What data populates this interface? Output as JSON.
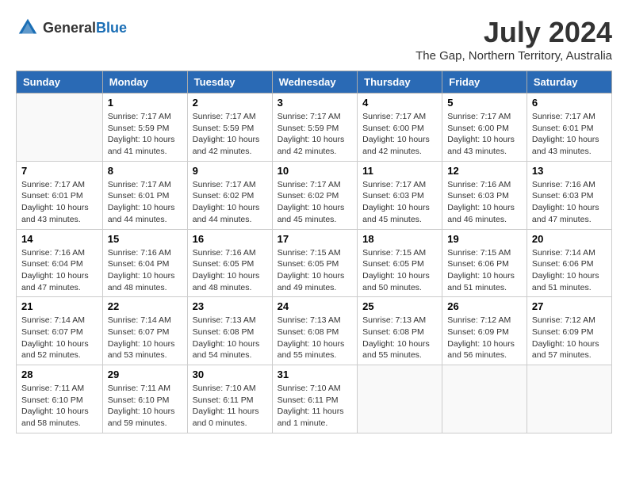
{
  "logo": {
    "general": "General",
    "blue": "Blue"
  },
  "title": {
    "month_year": "July 2024",
    "location": "The Gap, Northern Territory, Australia"
  },
  "headers": [
    "Sunday",
    "Monday",
    "Tuesday",
    "Wednesday",
    "Thursday",
    "Friday",
    "Saturday"
  ],
  "weeks": [
    [
      {
        "day": "",
        "info": ""
      },
      {
        "day": "1",
        "info": "Sunrise: 7:17 AM\nSunset: 5:59 PM\nDaylight: 10 hours\nand 41 minutes."
      },
      {
        "day": "2",
        "info": "Sunrise: 7:17 AM\nSunset: 5:59 PM\nDaylight: 10 hours\nand 42 minutes."
      },
      {
        "day": "3",
        "info": "Sunrise: 7:17 AM\nSunset: 5:59 PM\nDaylight: 10 hours\nand 42 minutes."
      },
      {
        "day": "4",
        "info": "Sunrise: 7:17 AM\nSunset: 6:00 PM\nDaylight: 10 hours\nand 42 minutes."
      },
      {
        "day": "5",
        "info": "Sunrise: 7:17 AM\nSunset: 6:00 PM\nDaylight: 10 hours\nand 43 minutes."
      },
      {
        "day": "6",
        "info": "Sunrise: 7:17 AM\nSunset: 6:01 PM\nDaylight: 10 hours\nand 43 minutes."
      }
    ],
    [
      {
        "day": "7",
        "info": "Sunrise: 7:17 AM\nSunset: 6:01 PM\nDaylight: 10 hours\nand 43 minutes."
      },
      {
        "day": "8",
        "info": "Sunrise: 7:17 AM\nSunset: 6:01 PM\nDaylight: 10 hours\nand 44 minutes."
      },
      {
        "day": "9",
        "info": "Sunrise: 7:17 AM\nSunset: 6:02 PM\nDaylight: 10 hours\nand 44 minutes."
      },
      {
        "day": "10",
        "info": "Sunrise: 7:17 AM\nSunset: 6:02 PM\nDaylight: 10 hours\nand 45 minutes."
      },
      {
        "day": "11",
        "info": "Sunrise: 7:17 AM\nSunset: 6:03 PM\nDaylight: 10 hours\nand 45 minutes."
      },
      {
        "day": "12",
        "info": "Sunrise: 7:16 AM\nSunset: 6:03 PM\nDaylight: 10 hours\nand 46 minutes."
      },
      {
        "day": "13",
        "info": "Sunrise: 7:16 AM\nSunset: 6:03 PM\nDaylight: 10 hours\nand 47 minutes."
      }
    ],
    [
      {
        "day": "14",
        "info": "Sunrise: 7:16 AM\nSunset: 6:04 PM\nDaylight: 10 hours\nand 47 minutes."
      },
      {
        "day": "15",
        "info": "Sunrise: 7:16 AM\nSunset: 6:04 PM\nDaylight: 10 hours\nand 48 minutes."
      },
      {
        "day": "16",
        "info": "Sunrise: 7:16 AM\nSunset: 6:05 PM\nDaylight: 10 hours\nand 48 minutes."
      },
      {
        "day": "17",
        "info": "Sunrise: 7:15 AM\nSunset: 6:05 PM\nDaylight: 10 hours\nand 49 minutes."
      },
      {
        "day": "18",
        "info": "Sunrise: 7:15 AM\nSunset: 6:05 PM\nDaylight: 10 hours\nand 50 minutes."
      },
      {
        "day": "19",
        "info": "Sunrise: 7:15 AM\nSunset: 6:06 PM\nDaylight: 10 hours\nand 51 minutes."
      },
      {
        "day": "20",
        "info": "Sunrise: 7:14 AM\nSunset: 6:06 PM\nDaylight: 10 hours\nand 51 minutes."
      }
    ],
    [
      {
        "day": "21",
        "info": "Sunrise: 7:14 AM\nSunset: 6:07 PM\nDaylight: 10 hours\nand 52 minutes."
      },
      {
        "day": "22",
        "info": "Sunrise: 7:14 AM\nSunset: 6:07 PM\nDaylight: 10 hours\nand 53 minutes."
      },
      {
        "day": "23",
        "info": "Sunrise: 7:13 AM\nSunset: 6:08 PM\nDaylight: 10 hours\nand 54 minutes."
      },
      {
        "day": "24",
        "info": "Sunrise: 7:13 AM\nSunset: 6:08 PM\nDaylight: 10 hours\nand 55 minutes."
      },
      {
        "day": "25",
        "info": "Sunrise: 7:13 AM\nSunset: 6:08 PM\nDaylight: 10 hours\nand 55 minutes."
      },
      {
        "day": "26",
        "info": "Sunrise: 7:12 AM\nSunset: 6:09 PM\nDaylight: 10 hours\nand 56 minutes."
      },
      {
        "day": "27",
        "info": "Sunrise: 7:12 AM\nSunset: 6:09 PM\nDaylight: 10 hours\nand 57 minutes."
      }
    ],
    [
      {
        "day": "28",
        "info": "Sunrise: 7:11 AM\nSunset: 6:10 PM\nDaylight: 10 hours\nand 58 minutes."
      },
      {
        "day": "29",
        "info": "Sunrise: 7:11 AM\nSunset: 6:10 PM\nDaylight: 10 hours\nand 59 minutes."
      },
      {
        "day": "30",
        "info": "Sunrise: 7:10 AM\nSunset: 6:11 PM\nDaylight: 11 hours\nand 0 minutes."
      },
      {
        "day": "31",
        "info": "Sunrise: 7:10 AM\nSunset: 6:11 PM\nDaylight: 11 hours\nand 1 minute."
      },
      {
        "day": "",
        "info": ""
      },
      {
        "day": "",
        "info": ""
      },
      {
        "day": "",
        "info": ""
      }
    ]
  ]
}
